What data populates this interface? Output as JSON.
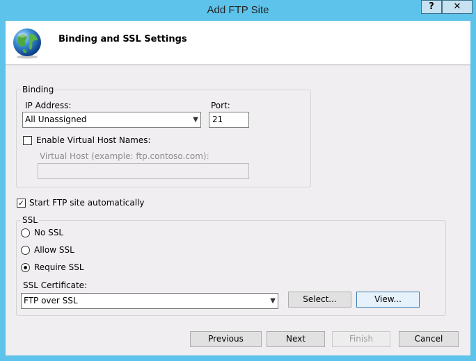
{
  "window": {
    "title": "Add FTP Site",
    "help_label": "?",
    "close_label": "✕"
  },
  "header": {
    "title": "Binding and SSL Settings",
    "icon": "globe-icon"
  },
  "binding": {
    "legend": "Binding",
    "ip_label": "IP Address:",
    "ip_value": "All Unassigned",
    "port_label": "Port:",
    "port_value": "21",
    "virtual_host_checkbox": "Enable Virtual Host Names:",
    "virtual_host_checked": false,
    "virtual_host_label": "Virtual Host (example: ftp.contoso.com):",
    "virtual_host_value": ""
  },
  "start_auto": {
    "label": "Start FTP site automatically",
    "checked": true
  },
  "ssl": {
    "legend": "SSL",
    "options": [
      "No SSL",
      "Allow SSL",
      "Require SSL"
    ],
    "selected": "Require SSL",
    "cert_label": "SSL Certificate:",
    "cert_value": "FTP over SSL",
    "select_button": "Select...",
    "view_button": "View..."
  },
  "footer": {
    "previous": "Previous",
    "next": "Next",
    "finish": "Finish",
    "cancel": "Cancel"
  }
}
